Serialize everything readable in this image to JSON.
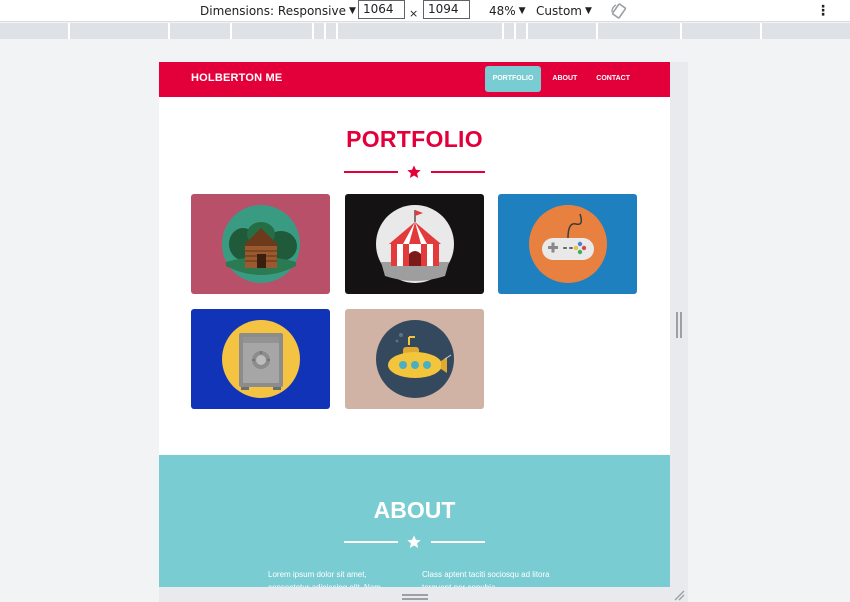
{
  "devtools": {
    "dimensions_label": "Dimensions: Responsive",
    "width": "1064",
    "times": "×",
    "height": "1094",
    "zoom": "48%",
    "throttle": "Custom",
    "caret": "▼",
    "more": "⋮"
  },
  "site": {
    "brand": "HOLBERTON ME",
    "nav": [
      "PORTFOLIO",
      "ABOUT",
      "CONTACT"
    ],
    "active_nav": "PORTFOLIO",
    "portfolio_title": "PORTFOLIO",
    "about_title": "ABOUT",
    "about_left": "Lorem ipsum dolor sit amet, consectetur adipiscing elit. Nam",
    "about_right": "Class aptent taciti sociosqu ad litora torquent per conubia"
  },
  "tiles": [
    {
      "name": "cabin",
      "bg": "#b9506a"
    },
    {
      "name": "circus-tent",
      "bg": "#151213"
    },
    {
      "name": "game-controller",
      "bg": "#1f80c0"
    },
    {
      "name": "safe",
      "bg": "#1033b7"
    },
    {
      "name": "submarine",
      "bg": "#d0b3a5"
    }
  ],
  "colors": {
    "brand_red": "#e3003a",
    "teal": "#79ccd2"
  }
}
